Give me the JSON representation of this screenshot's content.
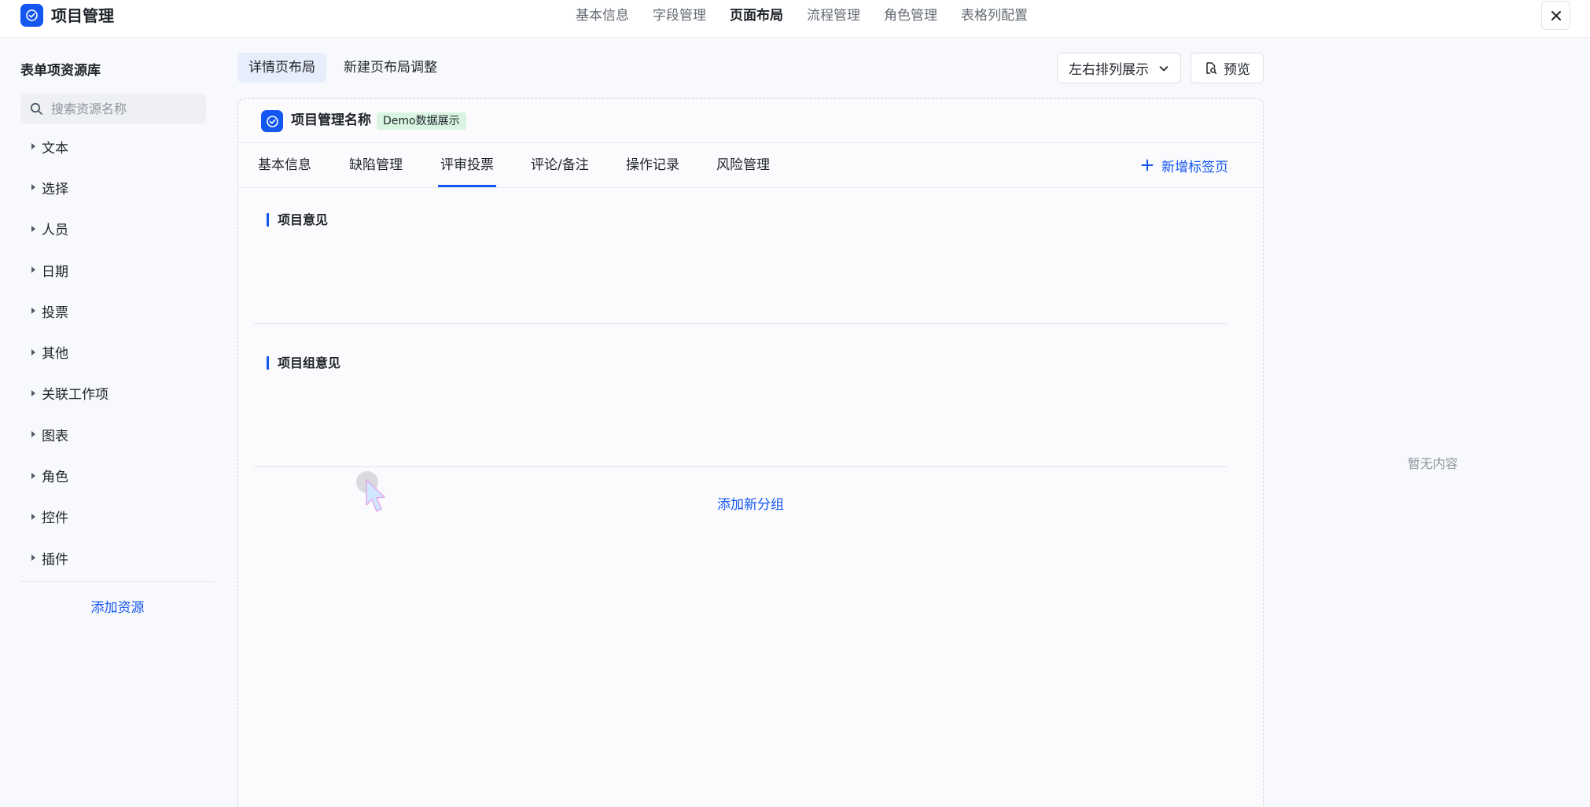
{
  "header": {
    "app_title": "项目管理",
    "nav": [
      "基本信息",
      "字段管理",
      "页面布局",
      "流程管理",
      "角色管理",
      "表格列配置"
    ],
    "active_nav": "页面布局"
  },
  "sidebar": {
    "title": "表单项资源库",
    "search_placeholder": "搜索资源名称",
    "categories": [
      "文本",
      "选择",
      "人员",
      "日期",
      "投票",
      "其他",
      "关联工作项",
      "图表",
      "角色",
      "控件",
      "插件"
    ],
    "add_resource": "添加资源"
  },
  "layout_tabs": [
    "详情页布局",
    "新建页布局调整"
  ],
  "arrange_select": {
    "value": "左右排列展示"
  },
  "preview_button": "预览",
  "project": {
    "name": "项目管理名称",
    "badge": "Demo数据展示",
    "tabs": [
      "基本信息",
      "缺陷管理",
      "评审投票",
      "评论/备注",
      "操作记录",
      "风险管理"
    ],
    "active_tab": "评审投票",
    "add_tab": "新增标签页",
    "sections": [
      "项目意见",
      "项目组意见"
    ],
    "add_group": "添加新分组"
  },
  "right_panel": {
    "empty_text": "暂无内容"
  },
  "colors": {
    "accent": "#1456f0",
    "badge_bg": "#d9f5e1"
  }
}
